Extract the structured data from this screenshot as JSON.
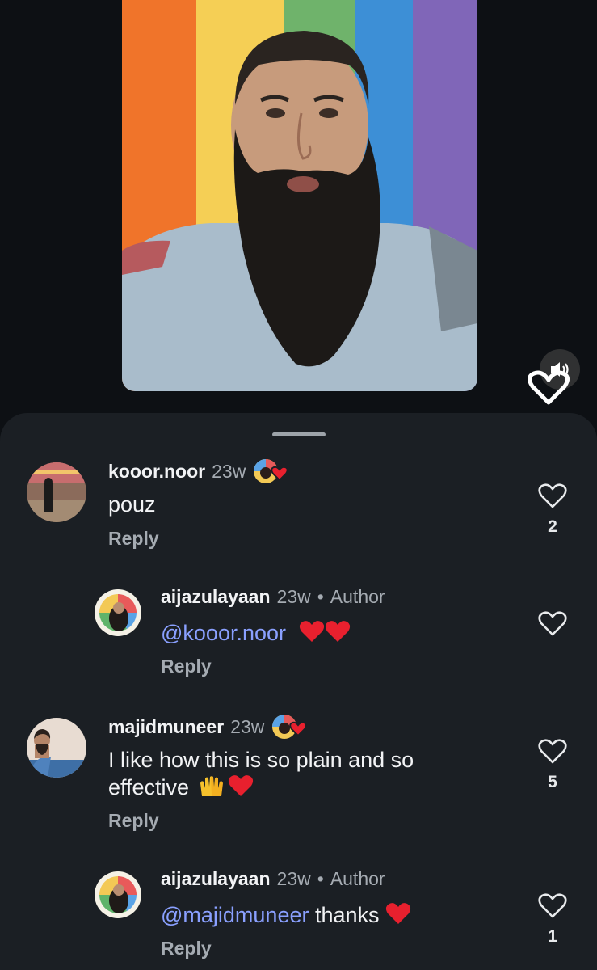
{
  "video": {
    "flag_colors": [
      "#f0742a",
      "#f5cf55",
      "#6fb36b",
      "#3d8fd6",
      "#8066b8"
    ],
    "speaker_icon": "speaker-on-icon"
  },
  "comments": [
    {
      "username": "kooor.noor",
      "time": "23w",
      "text": "pouz",
      "reply_label": "Reply",
      "likes": "2"
    },
    {
      "username": "aijazulayaan",
      "time": "23w",
      "dot": "•",
      "author_label": "Author",
      "mention": "@kooor.noor",
      "reply_label": "Reply",
      "likes": ""
    },
    {
      "username": "majidmuneer",
      "time": "23w",
      "text": "I like how this is so plain and so effective",
      "reply_label": "Reply",
      "likes": "5"
    },
    {
      "username": "aijazulayaan",
      "time": "23w",
      "dot": "•",
      "author_label": "Author",
      "mention": "@majidmuneer",
      "text_after": "thanks",
      "reply_label": "Reply",
      "likes": "1"
    }
  ],
  "colors": {
    "background": "#0d1014",
    "sheet": "#1b1f24",
    "mention": "#8aa0ff",
    "heart": "#e8202e",
    "secondary_text": "#a5abb2"
  },
  "icons": {
    "like": "heart-outline-icon",
    "creator_liked": "creator-heart-badge-icon",
    "emoji_heart": "red-heart-emoji",
    "emoji_hands": "raising-hands-emoji"
  }
}
